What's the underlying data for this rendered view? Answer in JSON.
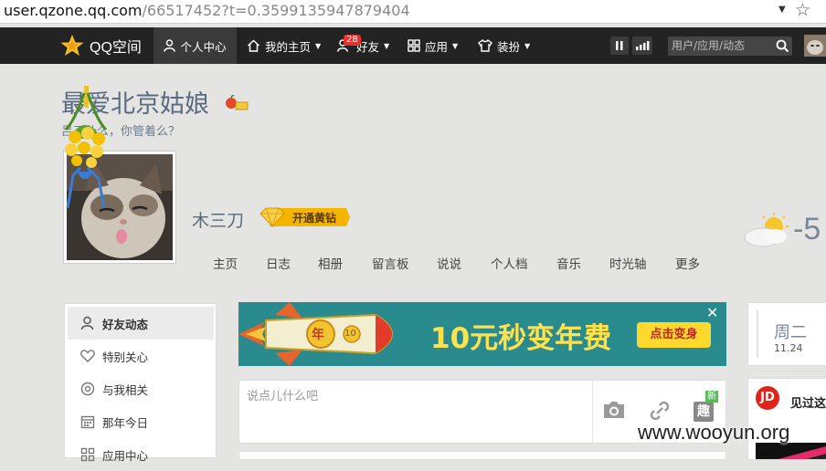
{
  "browser": {
    "url_host": "user.qzone.qq.com",
    "url_path": "/66517452?t=0.3599135947879404"
  },
  "topnav": {
    "logo_text": "QQ空间",
    "items": [
      {
        "label": "个人中心",
        "icon": "user-icon",
        "active": true
      },
      {
        "label": "我的主页",
        "icon": "home-icon"
      },
      {
        "label": "好友",
        "icon": "friends-icon",
        "badge": "28"
      },
      {
        "label": "应用",
        "icon": "apps-grid-icon"
      },
      {
        "label": "装扮",
        "icon": "tshirt-icon"
      }
    ],
    "search_placeholder": "用户/应用/动态"
  },
  "profile": {
    "site_title": "最爱北京姑娘",
    "subtitle": "吕了什么，你管着么？",
    "username": "木三刀",
    "vip_label": "开通黄钻",
    "temperature": "-5",
    "tabs": [
      "主页",
      "日志",
      "相册",
      "留言板",
      "说说",
      "个人档",
      "音乐",
      "时光轴",
      "更多"
    ]
  },
  "sidebar": {
    "items": [
      {
        "label": "好友动态",
        "icon": "person-icon",
        "active": true
      },
      {
        "label": "特别关心",
        "icon": "heart-icon"
      },
      {
        "label": "与我相关",
        "icon": "at-icon"
      },
      {
        "label": "那年今日",
        "icon": "calendar-icon"
      },
      {
        "label": "应用中心",
        "icon": "grid-icon"
      }
    ]
  },
  "banner": {
    "text": "10元秒变年费",
    "cta": "点击变身",
    "rocket_label": "年",
    "coin_label": "10"
  },
  "postbox": {
    "placeholder": "说点儿什么吧",
    "new_badge": "新",
    "fun_label": "趣"
  },
  "calendar": {
    "day": "周二",
    "date": "11.24"
  },
  "jd_ad": {
    "logo": "JD",
    "text": "见过这"
  },
  "watermark": "www.wooyun.org",
  "colors": {
    "nav_bg": "#232323",
    "banner_bg": "#2a8b8e",
    "banner_text": "#ffe14d",
    "badge_red": "#e5322d",
    "vip_gold": "#f5b400"
  }
}
